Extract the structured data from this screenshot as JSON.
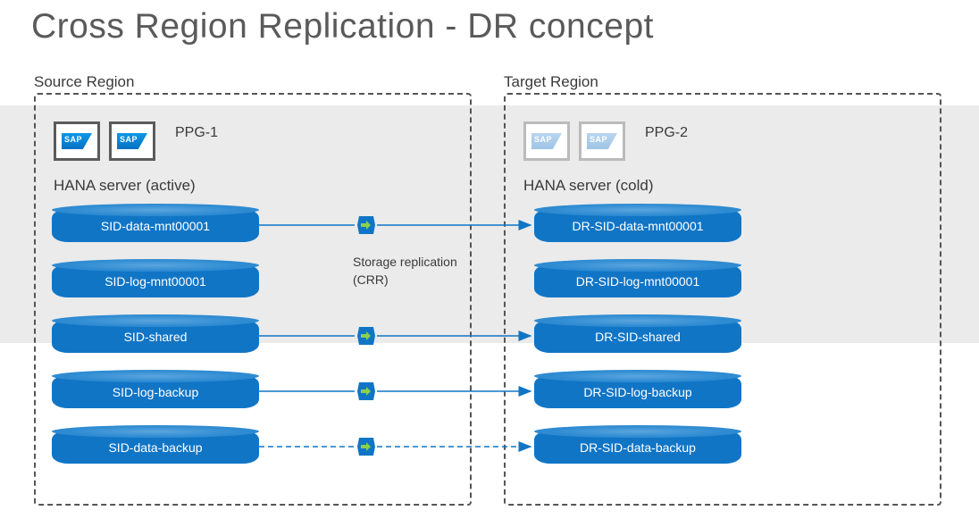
{
  "title": "Cross Region Replication - DR concept",
  "source": {
    "label": "Source Region",
    "ppg": "PPG-1",
    "hana": "HANA server (active)",
    "disks": [
      "SID-data-mnt00001",
      "SID-log-mnt00001",
      "SID-shared",
      "SID-log-backup",
      "SID-data-backup"
    ]
  },
  "target": {
    "label": "Target Region",
    "ppg": "PPG-2",
    "hana": "HANA server (cold)",
    "disks": [
      "DR-SID-data-mnt00001",
      "DR-SID-log-mnt00001",
      "DR-SID-shared",
      "DR-SID-log-backup",
      "DR-SID-data-backup"
    ]
  },
  "replication": {
    "line1": "Storage replication",
    "line2": "(CRR)"
  },
  "colors": {
    "disk": "#1175c6",
    "arrow": "#1175c6",
    "text": "#3a3a3a"
  }
}
